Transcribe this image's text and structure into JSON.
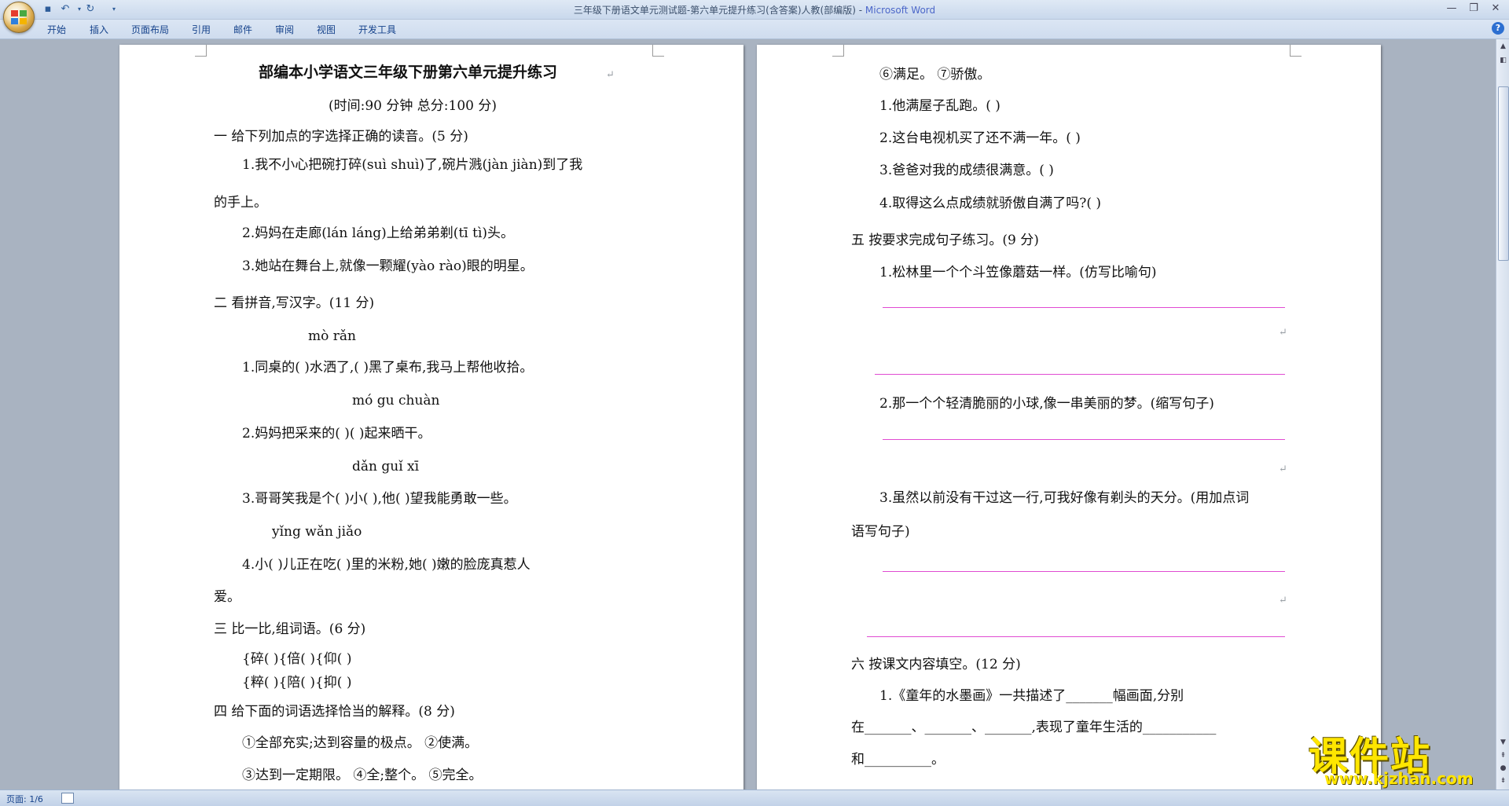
{
  "window": {
    "doc_title": "三年级下册语文单元测试题-第六单元提升练习(含答案)人教(部编版)",
    "separator": " - ",
    "app_name": "Microsoft Word"
  },
  "ribbon": {
    "tabs": [
      "开始",
      "插入",
      "页面布局",
      "引用",
      "邮件",
      "审阅",
      "视图",
      "开发工具"
    ]
  },
  "page1": [
    "部编本小学语文三年级下册第六单元提升练习",
    "(时间:90 分钟   总分:100 分)",
    "一   给下列加点的字选择正确的读音。(5 分)",
    "1.我不小心把碗打碎(suì  shuì)了,碗片溅(jàn  jiàn)到了我",
    "的手上。",
    "2.妈妈在走廊(lán  láng)上给弟弟剃(tī  tì)头。",
    "3.她站在舞台上,就像一颗耀(yào  rào)眼的明星。",
    "二   看拼音,写汉字。(11 分)",
    "mò          rǎn",
    "1.同桌的(  )水洒了,(  )黑了桌布,我马上帮他收拾。",
    "mó gu  chuàn",
    "2.妈妈把采来的(    )(  )起来晒干。",
    "dǎn    guǐ       xī",
    "3.哥哥笑我是个(  )小(  ),他(  )望我能勇敢一些。",
    "yǐng         wǎn             jiǎo",
    "4.小(  )儿正在吃(  )里的米粉,她(  )嫩的脸庞真惹人",
    "爱。",
    "三   比一比,组词语。(6 分)",
    "{碎(      ){倍(       ){仰(       )",
    "{粹(      ){陪(       ){抑(       )",
    "四   给下面的词语选择恰当的解释。(8 分)",
    "①全部充实;达到容量的极点。  ②使满。",
    "③达到一定期限。  ④全;整个。  ⑤完全。"
  ],
  "page2": [
    "⑥满足。   ⑦骄傲。",
    "1.他满屋子乱跑。(     )",
    "2.这台电视机买了还不满一年。(    )",
    "3.爸爸对我的成绩很满意。(    )",
    "4.取得这么点成绩就骄傲自满了吗?(    )",
    "五   按要求完成句子练习。(9 分)",
    "1.松林里一个个斗笠像蘑菇一样。(仿写比喻句)",
    "2.那一个个轻清脆丽的小球,像一串美丽的梦。(缩写句子)",
    "3.虽然以前没有干过这一行,可我好像有剃头的天分。(用加点词",
    "语写句子)",
    "六   按课文内容填空。(12 分)",
    "1.《童年的水墨画》一共描述了_______幅画面,分别",
    "在_______、_______、_______,表现了童年生活的___________",
    "和__________。"
  ],
  "status": {
    "pages": "页面: 1/6"
  },
  "watermark": {
    "cn": "课件站",
    "url": "www.kjzhan.com"
  }
}
